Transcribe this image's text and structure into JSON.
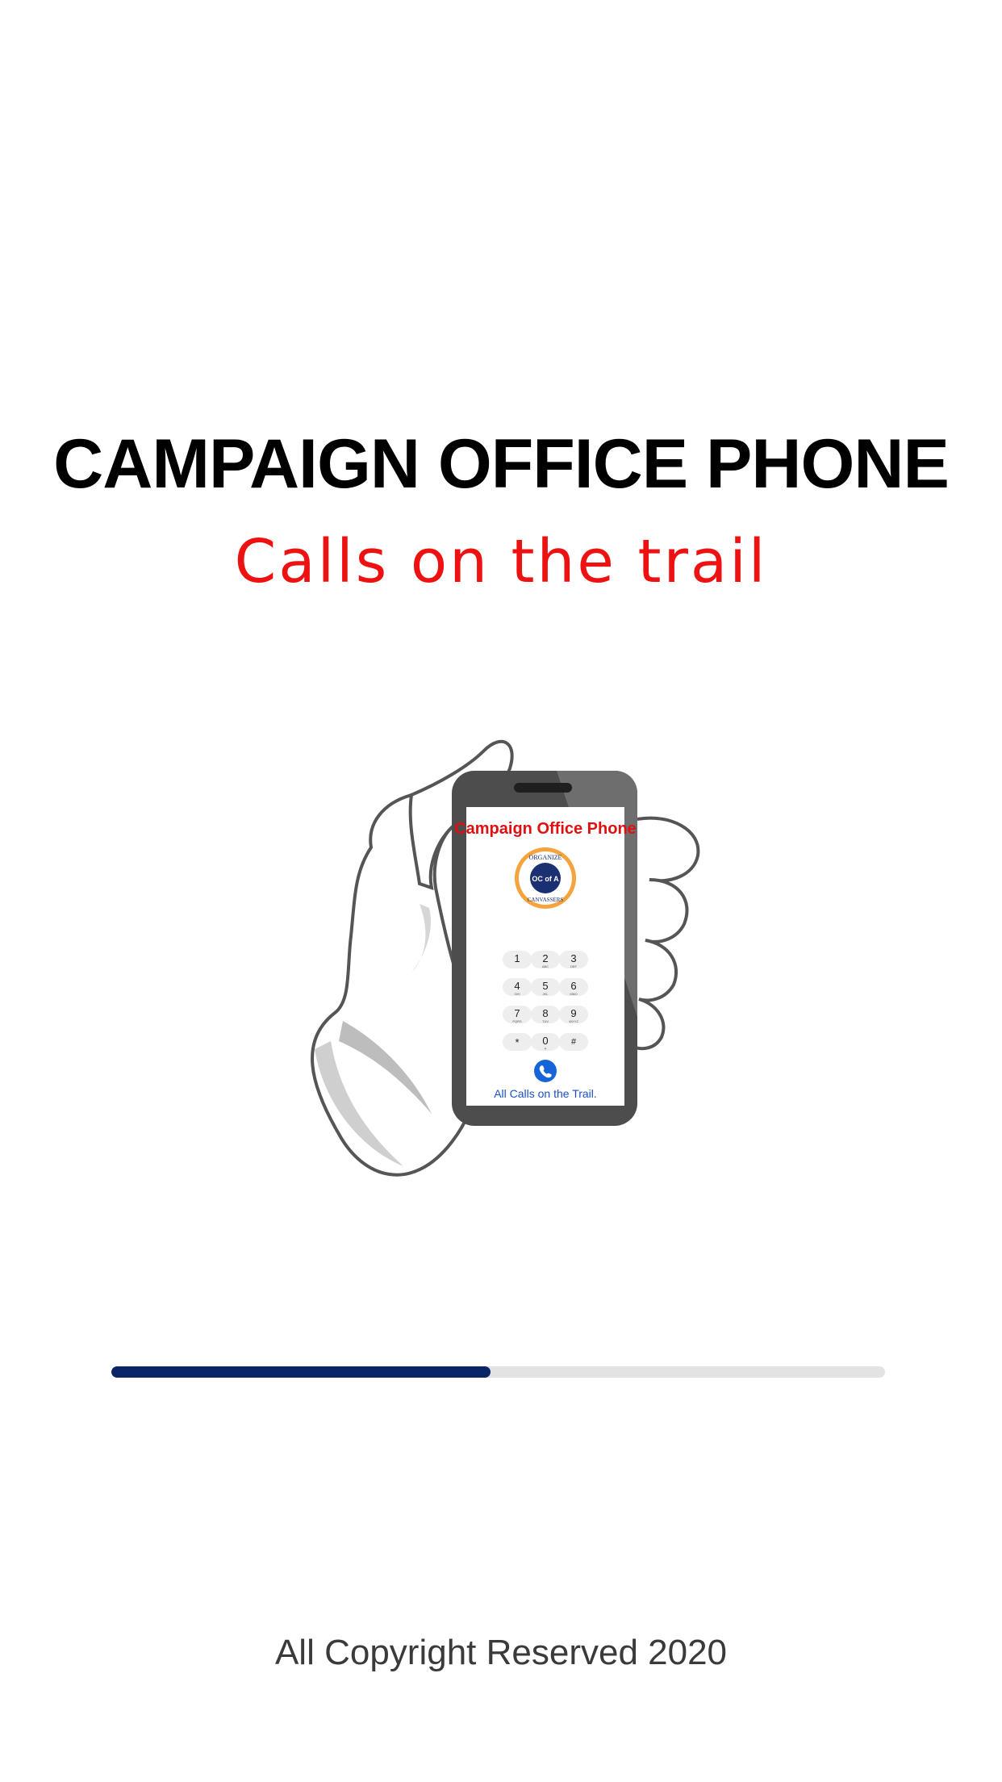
{
  "splash": {
    "title": "CAMPAIGN OFFICE PHONE",
    "subtitle": "Calls on the trail",
    "copyright": "All Copyright Reserved 2020"
  },
  "phone_screen": {
    "app_title": "Campaign Office Phone",
    "logo_top_text": "ORGANIZE",
    "logo_bottom_text": "CANVASSERS",
    "logo_center_text": "OC of A",
    "keypad": [
      {
        "digit": "1",
        "letters": ""
      },
      {
        "digit": "2",
        "letters": "ABC"
      },
      {
        "digit": "3",
        "letters": "DEF"
      },
      {
        "digit": "4",
        "letters": "GHI"
      },
      {
        "digit": "5",
        "letters": "JKL"
      },
      {
        "digit": "6",
        "letters": "MNO"
      },
      {
        "digit": "7",
        "letters": "PQRS"
      },
      {
        "digit": "8",
        "letters": "TUV"
      },
      {
        "digit": "9",
        "letters": "WXYZ"
      },
      {
        "digit": "*",
        "letters": ""
      },
      {
        "digit": "0",
        "letters": "+"
      },
      {
        "digit": "#",
        "letters": ""
      }
    ],
    "footer": "All Calls on the Trail."
  },
  "progress": {
    "value": 0.49
  },
  "colors": {
    "title": "#000000",
    "subtitle": "#ee1111",
    "progress_fill": "#0a2468",
    "progress_track": "#e3e3e3",
    "call_button": "#1565d8",
    "phone_body": "#4d4d4d",
    "app_title": "#e01010",
    "footer_text": "#1a4fc4"
  },
  "icons": {
    "call": "phone-call-icon",
    "illustration": "hand-holding-phone"
  }
}
